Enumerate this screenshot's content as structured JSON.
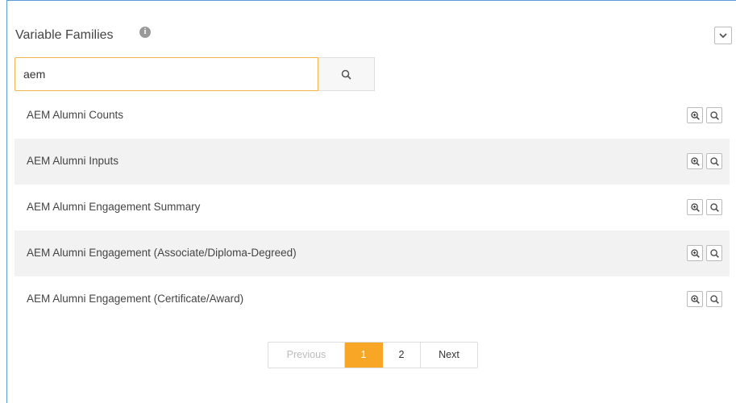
{
  "header": {
    "title": "Variable Families",
    "info_icon": "info-icon",
    "collapse_icon": "chevron-down-icon"
  },
  "search": {
    "value": "aem",
    "button_icon": "search-icon"
  },
  "rows": [
    {
      "label": "AEM Alumni Counts"
    },
    {
      "label": "AEM Alumni Inputs"
    },
    {
      "label": "AEM Alumni Engagement Summary"
    },
    {
      "label": "AEM Alumni Engagement (Associate/Diploma-Degreed)"
    },
    {
      "label": "AEM Alumni Engagement (Certificate/Award)"
    }
  ],
  "row_actions": [
    "zoom-in-icon",
    "search-icon"
  ],
  "pagination": {
    "previous": "Previous",
    "pages": [
      "1",
      "2"
    ],
    "active_page": "1",
    "next": "Next"
  },
  "colors": {
    "accent": "#f7a625",
    "frame_border": "#5b9bd5",
    "alt_row": "#f2f2f2"
  }
}
